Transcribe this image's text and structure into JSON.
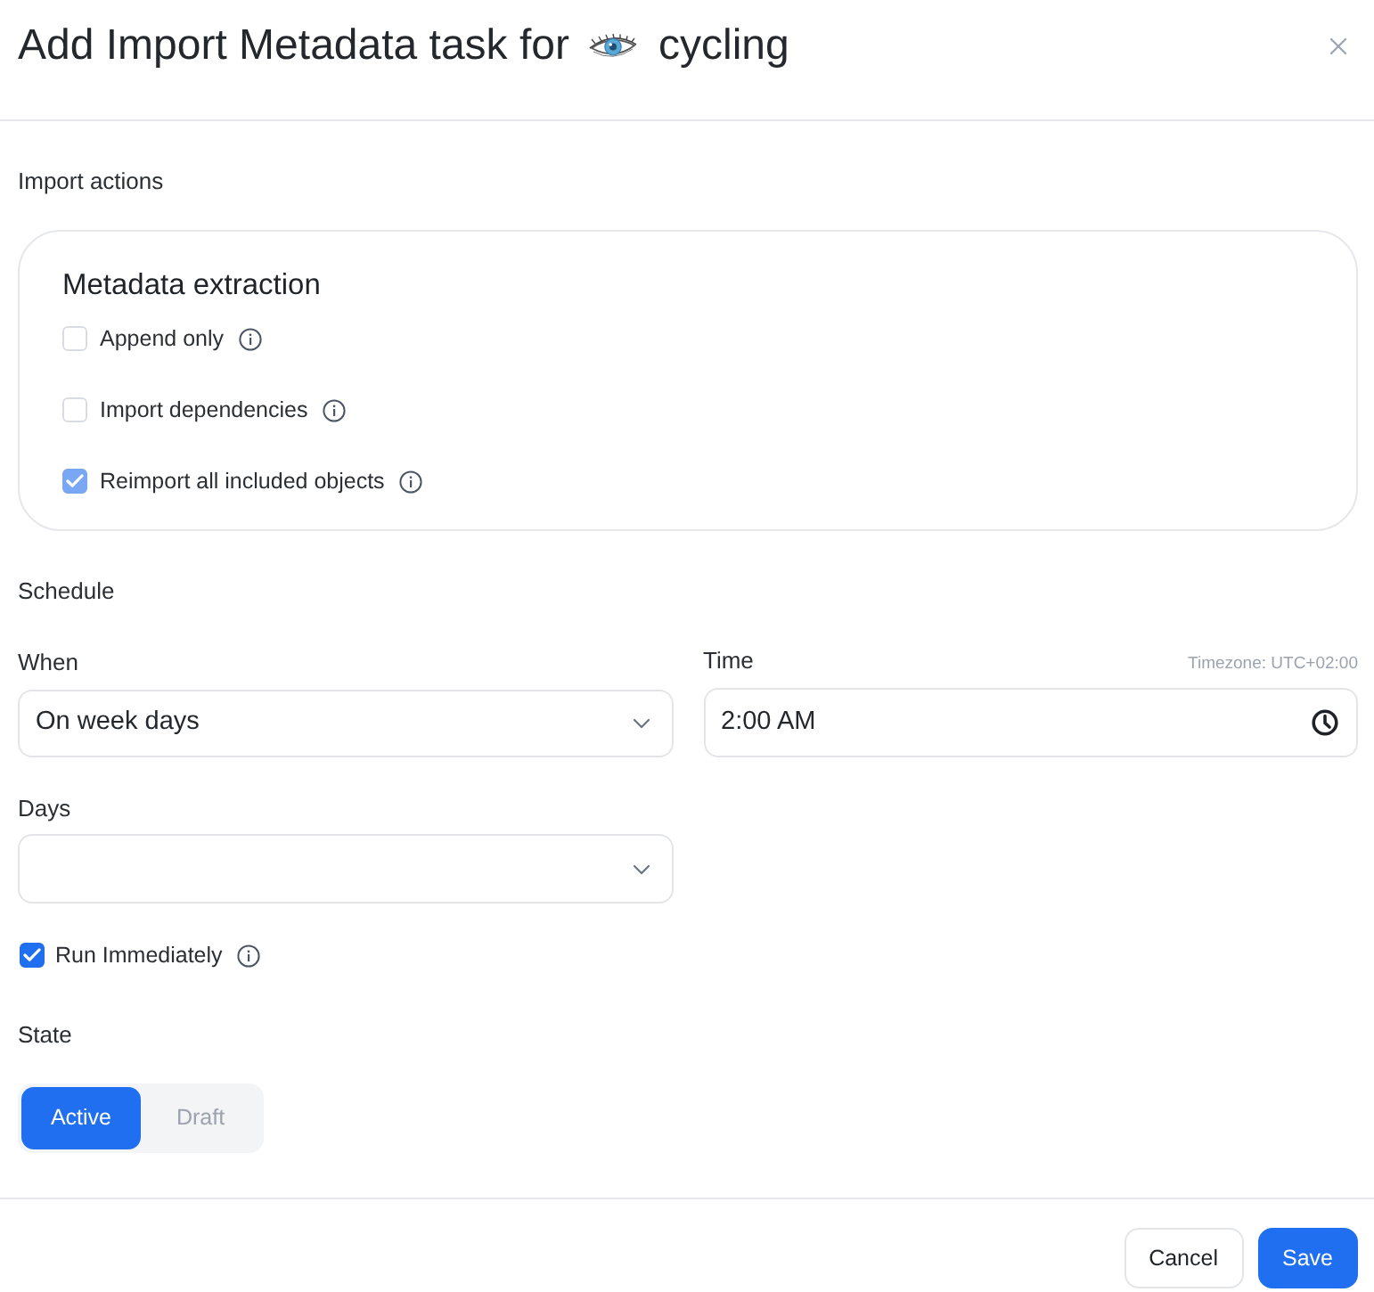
{
  "dialog": {
    "title": "Add Import Metadata task for",
    "subject": "cycling"
  },
  "import_actions": {
    "label": "Import actions",
    "card": {
      "title": "Metadata extraction",
      "options": [
        {
          "label": "Append only",
          "checked": false,
          "disabled": false
        },
        {
          "label": "Import dependencies",
          "checked": false,
          "disabled": false
        },
        {
          "label": "Reimport all included objects",
          "checked": true,
          "disabled": true
        }
      ]
    }
  },
  "schedule": {
    "label": "Schedule",
    "when": {
      "label": "When",
      "value": "On week days"
    },
    "time": {
      "label": "Time",
      "timezone": "Timezone: UTC+02:00",
      "value": "2:00 AM"
    },
    "days": {
      "label": "Days"
    },
    "run_immediately": {
      "label": "Run Immediately",
      "checked": true
    }
  },
  "state": {
    "label": "State",
    "options": [
      {
        "label": "Active",
        "selected": true
      },
      {
        "label": "Draft",
        "selected": false
      }
    ]
  },
  "footer": {
    "buttons": [
      {
        "label": "Cancel",
        "kind": "secondary"
      },
      {
        "label": "Save",
        "kind": "primary"
      }
    ]
  }
}
